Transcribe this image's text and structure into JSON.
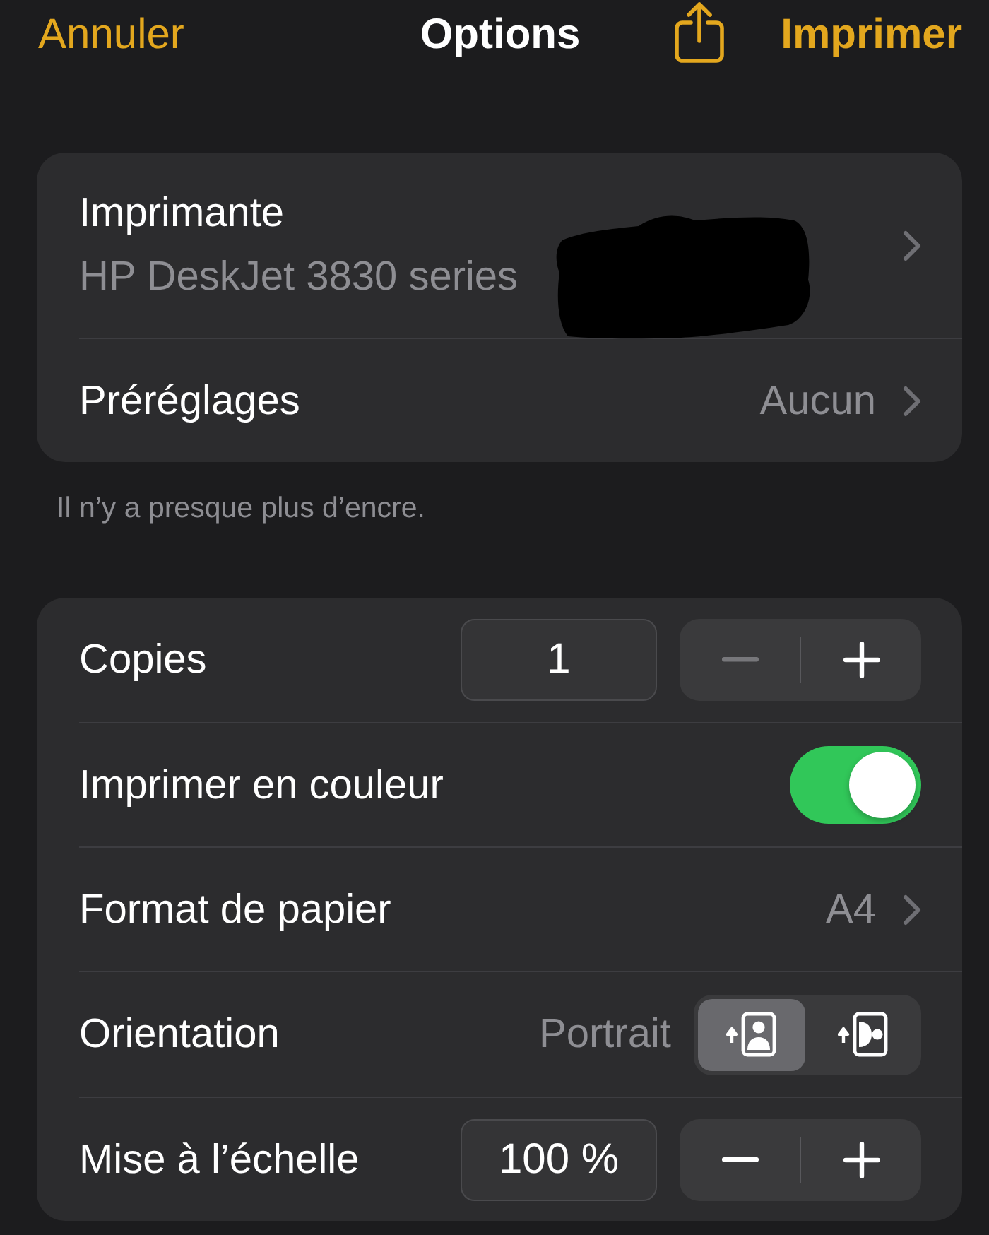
{
  "nav": {
    "cancel": "Annuler",
    "title": "Options",
    "print": "Imprimer"
  },
  "printer_section": {
    "rows": [
      {
        "kind": "detail",
        "label": "Imprimante",
        "subtitle": "HP DeskJet 3830 series",
        "redacted": true
      },
      {
        "kind": "value",
        "label": "Préréglages",
        "value": "Aucun"
      }
    ],
    "footer": "Il n’y a presque plus d’encre."
  },
  "options_section": {
    "rows": [
      {
        "kind": "stepper",
        "label": "Copies",
        "value": "1",
        "decrement_disabled": true,
        "increment_disabled": false
      },
      {
        "kind": "toggle",
        "label": "Imprimer en couleur",
        "on": true
      },
      {
        "kind": "value",
        "label": "Format de papier",
        "value": "A4"
      },
      {
        "kind": "segmented",
        "label": "Orientation",
        "value": "Portrait",
        "options": [
          {
            "kind": "portrait",
            "selected": true
          },
          {
            "kind": "landscape",
            "selected": false
          }
        ]
      },
      {
        "kind": "stepper",
        "label": "Mise à l’échelle",
        "value": "100 %",
        "decrement_disabled": false,
        "increment_disabled": false
      }
    ]
  }
}
